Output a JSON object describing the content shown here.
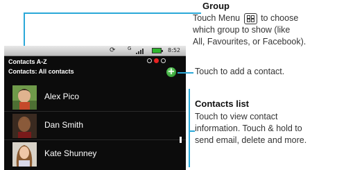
{
  "status_bar": {
    "network_type": "G",
    "time": "8:52"
  },
  "header": {
    "title": "Contacts A-Z",
    "subtitle": "Contacts: All contacts"
  },
  "add_button": {
    "symbol": "+"
  },
  "contacts": [
    {
      "name": "Alex Pico"
    },
    {
      "name": "Dan Smith"
    },
    {
      "name": "Kate Shunney"
    }
  ],
  "callouts": {
    "group": {
      "title": "Group",
      "line1_before": "Touch Menu",
      "line1_after": "to choose",
      "line2": "which group to show (like",
      "line3": "All, Favourites, or Facebook)."
    },
    "add_contact": {
      "text": "Touch to add a contact."
    },
    "contacts_list": {
      "title": "Contacts list",
      "line1": "Touch to view contact",
      "line2": "information. Touch & hold to",
      "line3": "send email, delete and more."
    }
  },
  "colors": {
    "callout_line": "#2aa8d8",
    "add_button": "#2fa32f",
    "active_dot": "#e62222"
  }
}
